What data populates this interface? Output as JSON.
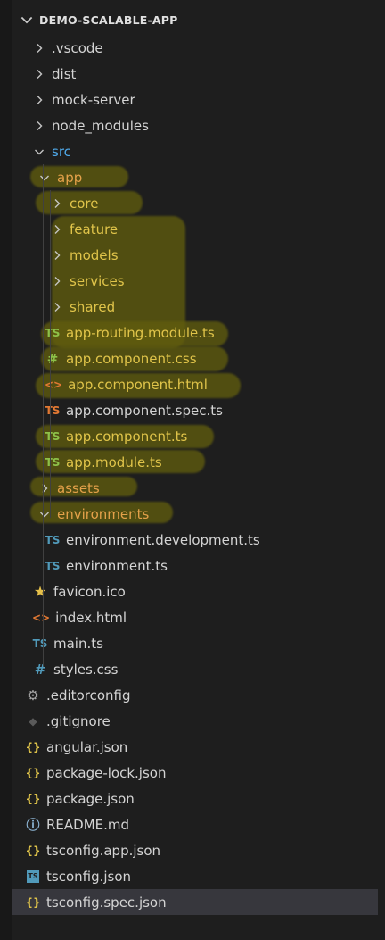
{
  "explorer": {
    "project_name": "DEMO-SCALABLE-APP"
  },
  "tree": [
    {
      "label": ".vscode",
      "kind": "folder",
      "expanded": false,
      "depth": 1
    },
    {
      "label": "dist",
      "kind": "folder",
      "expanded": false,
      "depth": 1
    },
    {
      "label": "mock-server",
      "kind": "folder",
      "expanded": false,
      "depth": 1
    },
    {
      "label": "node_modules",
      "kind": "folder",
      "expanded": false,
      "depth": 1
    },
    {
      "label": "src",
      "kind": "folder",
      "expanded": true,
      "depth": 1,
      "color": "#4fa8e8"
    },
    {
      "label": "app",
      "kind": "folder",
      "expanded": true,
      "depth": 2,
      "color": "#e4a14a"
    },
    {
      "label": "core",
      "kind": "folder",
      "expanded": false,
      "depth": 3,
      "color": "#e0c44a"
    },
    {
      "label": "feature",
      "kind": "folder",
      "expanded": false,
      "depth": 3,
      "color": "#e0c44a"
    },
    {
      "label": "models",
      "kind": "folder",
      "expanded": false,
      "depth": 3,
      "color": "#e0c44a"
    },
    {
      "label": "services",
      "kind": "folder",
      "expanded": false,
      "depth": 3,
      "color": "#e0c44a"
    },
    {
      "label": "shared",
      "kind": "folder",
      "expanded": false,
      "depth": 3,
      "color": "#e0c44a"
    },
    {
      "label": "app-routing.module.ts",
      "kind": "file",
      "icon": "ts-icon",
      "glyph": "TS",
      "iconColor": "#8dc149",
      "depth": 3,
      "color": "#e0c44a"
    },
    {
      "label": "app.component.css",
      "kind": "file",
      "icon": "css-hash-icon",
      "glyph": "#",
      "iconColor": "#8dc149",
      "depth": 3,
      "color": "#e0c44a"
    },
    {
      "label": "app.component.html",
      "kind": "file",
      "icon": "html-icon",
      "glyph": "<>",
      "iconColor": "#e37933",
      "depth": 3,
      "color": "#e0c44a"
    },
    {
      "label": "app.component.spec.ts",
      "kind": "file",
      "icon": "ts-spec-icon",
      "glyph": "TS",
      "iconColor": "#e37933",
      "depth": 3,
      "color": "#d4d4d4"
    },
    {
      "label": "app.component.ts",
      "kind": "file",
      "icon": "ts-icon",
      "glyph": "TS",
      "iconColor": "#8dc149",
      "depth": 3,
      "color": "#e0c44a"
    },
    {
      "label": "app.module.ts",
      "kind": "file",
      "icon": "ts-icon",
      "glyph": "TS",
      "iconColor": "#8dc149",
      "depth": 3,
      "color": "#e0c44a"
    },
    {
      "label": "assets",
      "kind": "folder",
      "expanded": false,
      "depth": 2,
      "color": "#e4a14a"
    },
    {
      "label": "environments",
      "kind": "folder",
      "expanded": true,
      "depth": 2,
      "color": "#e4a14a"
    },
    {
      "label": "environment.development.ts",
      "kind": "file",
      "icon": "ts-icon",
      "glyph": "TS",
      "iconColor": "#519aba",
      "depth": 3,
      "color": "#d4d4d4"
    },
    {
      "label": "environment.ts",
      "kind": "file",
      "icon": "ts-icon",
      "glyph": "TS",
      "iconColor": "#519aba",
      "depth": 3,
      "color": "#d4d4d4"
    },
    {
      "label": "favicon.ico",
      "kind": "file",
      "icon": "star-icon",
      "glyph": "★",
      "iconColor": "#e5c04a",
      "depth": 2,
      "color": "#d4d4d4"
    },
    {
      "label": "index.html",
      "kind": "file",
      "icon": "html-icon",
      "glyph": "<>",
      "iconColor": "#e37933",
      "depth": 2,
      "color": "#d4d4d4"
    },
    {
      "label": "main.ts",
      "kind": "file",
      "icon": "ts-icon",
      "glyph": "TS",
      "iconColor": "#519aba",
      "depth": 2,
      "color": "#d4d4d4"
    },
    {
      "label": "styles.css",
      "kind": "file",
      "icon": "css-hash-icon",
      "glyph": "#",
      "iconColor": "#519aba",
      "depth": 2,
      "color": "#d4d4d4"
    },
    {
      "label": ".editorconfig",
      "kind": "file",
      "icon": "gear-icon",
      "glyph": "⚙",
      "iconColor": "#a8a8a8",
      "depth": 1,
      "color": "#d4d4d4"
    },
    {
      "label": ".gitignore",
      "kind": "file",
      "icon": "git-icon",
      "glyph": "◆",
      "iconColor": "#5a5a5a",
      "depth": 1,
      "color": "#d4d4d4"
    },
    {
      "label": "angular.json",
      "kind": "file",
      "icon": "json-braces-icon",
      "glyph": "{}",
      "iconColor": "#e0c44a",
      "depth": 1,
      "color": "#d4d4d4"
    },
    {
      "label": "package-lock.json",
      "kind": "file",
      "icon": "json-braces-icon",
      "glyph": "{}",
      "iconColor": "#e0c44a",
      "depth": 1,
      "color": "#d4d4d4"
    },
    {
      "label": "package.json",
      "kind": "file",
      "icon": "json-braces-icon",
      "glyph": "{}",
      "iconColor": "#e0c44a",
      "depth": 1,
      "color": "#d4d4d4"
    },
    {
      "label": "README.md",
      "kind": "file",
      "icon": "info-icon",
      "glyph": "ⓘ",
      "iconColor": "#8fb8d8",
      "depth": 1,
      "color": "#d4d4d4"
    },
    {
      "label": "tsconfig.app.json",
      "kind": "file",
      "icon": "json-braces-icon",
      "glyph": "{}",
      "iconColor": "#e0c44a",
      "depth": 1,
      "color": "#d4d4d4"
    },
    {
      "label": "tsconfig.json",
      "kind": "file",
      "icon": "tsconfig-icon",
      "glyph": "TS",
      "iconColor": "#519aba",
      "depth": 1,
      "color": "#d4d4d4"
    },
    {
      "label": "tsconfig.spec.json",
      "kind": "file",
      "icon": "json-braces-icon",
      "glyph": "{}",
      "iconColor": "#e0c44a",
      "depth": 1,
      "color": "#d4d4d4",
      "selected": true
    }
  ]
}
